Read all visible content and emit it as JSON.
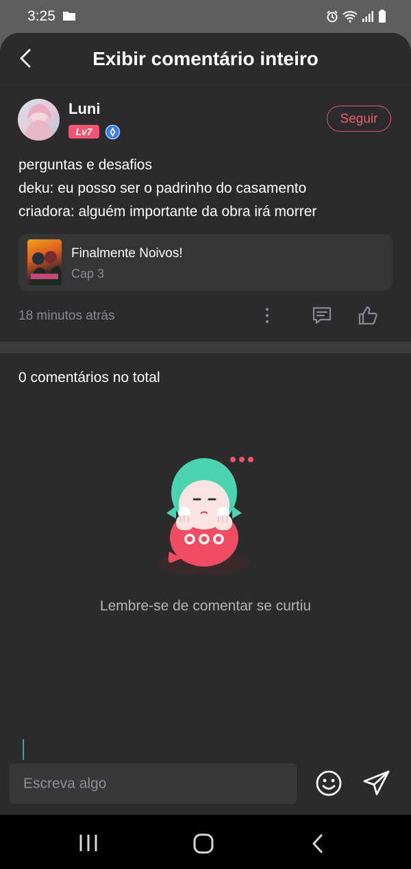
{
  "status_bar": {
    "time": "3:25",
    "icons": [
      "folder-icon",
      "alarm-icon",
      "wifi-icon",
      "signal-icon",
      "battery-icon"
    ]
  },
  "header": {
    "title": "Exibir comentário inteiro"
  },
  "comment": {
    "user": {
      "name": "Luni",
      "level": "Lv7"
    },
    "follow_label": "Seguir",
    "lines": [
      "perguntas e desafios",
      "deku: eu posso ser o padrinho do casamento",
      "criadora: alguém importante da obra irá morrer"
    ],
    "book": {
      "title": "Finalmente Noivos!",
      "chapter": "Cap 3"
    },
    "time": "18 minutos atrás"
  },
  "replies": {
    "total_label": "0 comentários no total",
    "empty_text": "Lembre-se de comentar se curtiu"
  },
  "input": {
    "placeholder": "Escreva algo"
  },
  "colors": {
    "accent": "#f05b73",
    "background": "#2b2b2d",
    "teal": "#17b39b"
  }
}
